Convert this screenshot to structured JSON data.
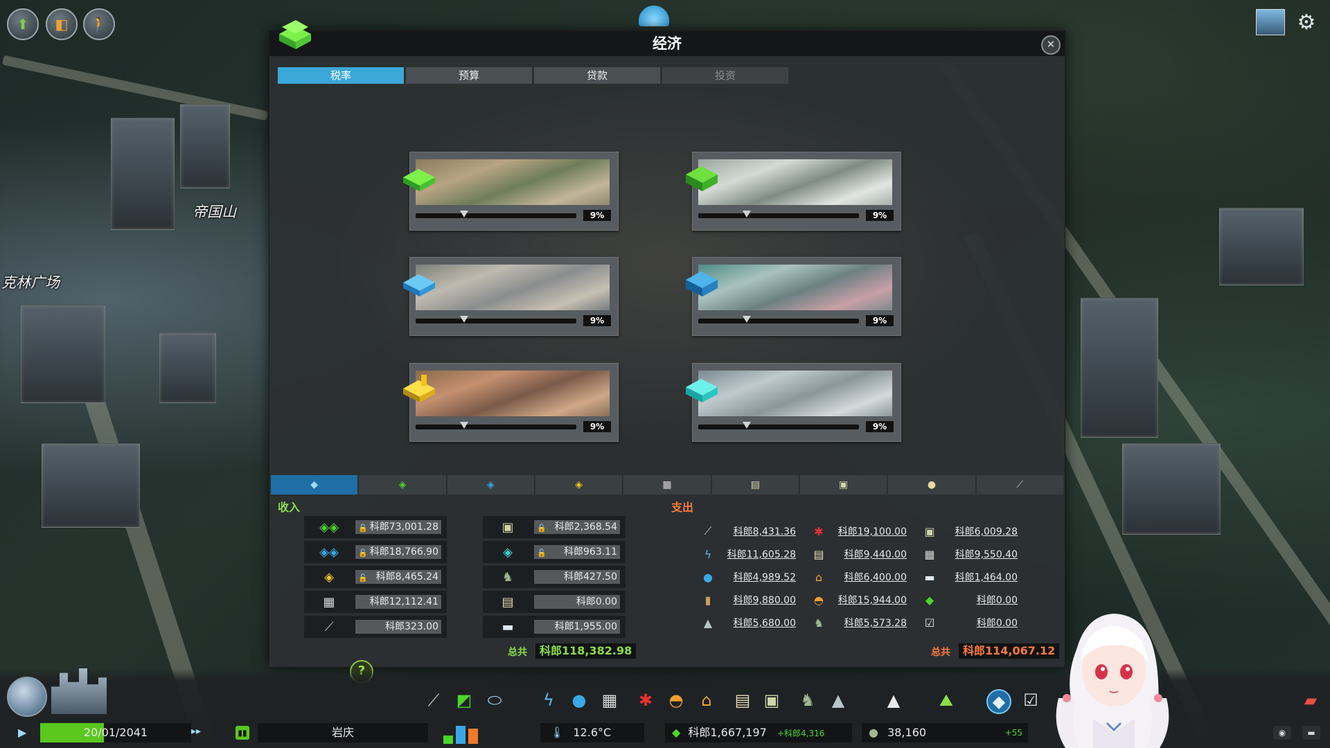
{
  "map": {
    "labels": [
      "帝国山",
      "克林广场"
    ]
  },
  "top_left_buttons": [
    "upgrade-icon",
    "info-views-icon",
    "pedestrian-icon"
  ],
  "top_right_buttons": [
    "city-thumbnail-icon",
    "gear-icon"
  ],
  "window": {
    "title": "经济",
    "close_icon": "close-icon",
    "tabs": [
      {
        "label": "税率",
        "state": "active"
      },
      {
        "label": "预算",
        "state": "normal"
      },
      {
        "label": "贷款",
        "state": "normal"
      },
      {
        "label": "投资",
        "state": "disabled"
      }
    ],
    "tax_rates": [
      {
        "zone": "residential-low",
        "value": "9%",
        "color": "#4cd62a",
        "level": 9
      },
      {
        "zone": "residential-high",
        "value": "9%",
        "color": "#3cc72a",
        "level": 9
      },
      {
        "zone": "commercial-low",
        "value": "9%",
        "color": "#3aa8e6",
        "level": 9
      },
      {
        "zone": "commercial-high",
        "value": "9%",
        "color": "#2a90d2",
        "level": 9
      },
      {
        "zone": "industrial",
        "value": "9%",
        "color": "#f2c21a",
        "level": 9
      },
      {
        "zone": "office",
        "value": "9%",
        "color": "#35d6d0",
        "level": 9
      }
    ],
    "categories": [
      {
        "icon": "overview-icon",
        "color": "#3aa8e6",
        "active": true
      },
      {
        "icon": "residential-icon",
        "color": "#4cd62a",
        "active": false
      },
      {
        "icon": "commercial-icon",
        "color": "#3aa8e6",
        "active": false
      },
      {
        "icon": "industrial-icon",
        "color": "#f2c21a",
        "active": false
      },
      {
        "icon": "industry-icon",
        "color": "#d8d8d8",
        "active": false
      },
      {
        "icon": "education-icon",
        "color": "#d8d8d8",
        "active": false
      },
      {
        "icon": "transport-icon",
        "color": "#d8d8d8",
        "active": false
      },
      {
        "icon": "tourism-icon",
        "color": "#d8d8d8",
        "active": false
      },
      {
        "icon": "road-icon",
        "color": "#d8d8d8",
        "active": false
      }
    ],
    "income": {
      "label": "收入",
      "left_column": [
        {
          "icon": "residential-icon",
          "value": "科郎73,001.28",
          "locked": true
        },
        {
          "icon": "commercial-icon",
          "value": "科郎18,766.90",
          "locked": true
        },
        {
          "icon": "industrial-icon",
          "value": "科郎8,465.24",
          "locked": true
        },
        {
          "icon": "industry-icon",
          "value": "科郎12,112.41",
          "locked": false
        },
        {
          "icon": "road-icon",
          "value": "科郎323.00",
          "locked": false
        }
      ],
      "right_column": [
        {
          "icon": "transport-icon",
          "value": "科郎2,368.54",
          "locked": true
        },
        {
          "icon": "office-icon",
          "value": "科郎963.11",
          "locked": true
        },
        {
          "icon": "park-icon",
          "value": "科郎427.50",
          "locked": false
        },
        {
          "icon": "education-icon",
          "value": "科郎0.00",
          "locked": false
        },
        {
          "icon": "tourism-icon",
          "value": "科郎1,955.00",
          "locked": false
        }
      ],
      "total_label": "总共",
      "total": "科郎118,382.98"
    },
    "expenses": {
      "label": "支出",
      "col1": [
        {
          "icon": "road-icon",
          "value": "科郎8,431.36"
        },
        {
          "icon": "electricity-icon",
          "value": "科郎11,605.28"
        },
        {
          "icon": "water-icon",
          "value": "科郎4,989.52"
        },
        {
          "icon": "garbage-icon",
          "value": "科郎9,880.00"
        },
        {
          "icon": "monument-icon",
          "value": "科郎5,680.00"
        }
      ],
      "col2": [
        {
          "icon": "healthcare-icon",
          "value": "科郎19,100.00"
        },
        {
          "icon": "education-icon",
          "value": "科郎9,440.00"
        },
        {
          "icon": "police-icon",
          "value": "科郎6,400.00"
        },
        {
          "icon": "fire-icon",
          "value": "科郎15,944.00"
        },
        {
          "icon": "park-icon",
          "value": "科郎5,573.28"
        }
      ],
      "col3": [
        {
          "icon": "transport-icon",
          "value": "科郎6,009.28",
          "locked": true
        },
        {
          "icon": "industry-icon",
          "value": "科郎9,550.40"
        },
        {
          "icon": "tourism-icon",
          "value": "科郎1,464.00"
        },
        {
          "icon": "policy-icon",
          "value": "科郎0.00"
        },
        {
          "icon": "checkbox-icon",
          "value": "科郎0.00"
        }
      ],
      "total_label": "总共",
      "total": "科郎114,067.12"
    },
    "help_icon": "help-icon"
  },
  "toolbar": {
    "tools": [
      "roads-icon",
      "zoning-icon",
      "districts-icon",
      "electricity-icon",
      "water-icon",
      "garbage-icon",
      "healthcare-icon",
      "fire-icon",
      "police-icon",
      "education-icon",
      "transport-icon",
      "parks-icon",
      "monuments-icon",
      "wonders-icon",
      "landscaping-icon",
      "economy-icon",
      "policies-icon",
      "bulldozer-icon"
    ]
  },
  "status": {
    "date": "20/01/2041",
    "city_name": "岩庆",
    "temperature": "12.6°C",
    "money": "科郎1,667,197",
    "money_delta": "+科郎4,316",
    "population": "38,160",
    "population_delta": "+55"
  }
}
